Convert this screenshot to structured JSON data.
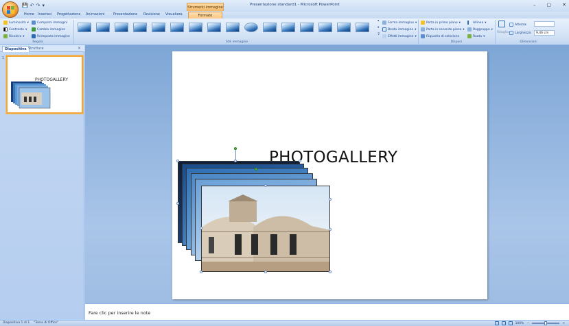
{
  "window": {
    "title": "Presentazione standard1 - Microsoft PowerPoint",
    "context_tab_group": "Strumenti immagine",
    "minimize": "–",
    "restore": "▢",
    "close": "✕"
  },
  "qat": {
    "save": "💾",
    "undo": "↶",
    "redo": "↷",
    "more": "▾"
  },
  "tabs": [
    "Home",
    "Inserisci",
    "Progettazione",
    "Animazioni",
    "Presentazione",
    "Revisione",
    "Visualizza"
  ],
  "active_tab": "Formato",
  "ribbon": {
    "regola": {
      "label": "Regola",
      "brightness": "Luminosità",
      "contrast": "Contrasto",
      "recolor": "Ricolora",
      "compress": "Comprimi immagini",
      "change": "Cambia immagine",
      "reset": "Reimposta immagine"
    },
    "stili": {
      "label": "Stili immagine",
      "thumb_count": 16
    },
    "stili_right": {
      "shape": "Forma immagine",
      "border": "Bordo immagine",
      "effects": "Effetti immagine"
    },
    "disponi": {
      "label": "Disponi",
      "bring_front": "Porta in primo piano",
      "send_back": "Porta in secondo piano",
      "selection_pane": "Riquadro di selezione",
      "align": "Allinea",
      "group": "Raggruppa",
      "rotate": "Ruota"
    },
    "dimensioni": {
      "label": "Dimensioni",
      "crop": "Ritaglia",
      "height_label": "Altezza:",
      "height_value": "",
      "width_label": "Larghezza:",
      "width_value": "9,46 cm"
    }
  },
  "pane": {
    "tab_slides": "Diapositive",
    "tab_outline": "Struttura",
    "close": "×",
    "slide_number": "1",
    "thumb_title": "PHOTOGALLERY"
  },
  "slide": {
    "title": "PHOTOGALLERY"
  },
  "notes": {
    "placeholder": "Fare clic per inserire le note"
  },
  "status": {
    "slide_info": "Diapositiva 1 di 1",
    "theme": "\"Tema di Office\"",
    "zoom": "100%",
    "zoom_out": "−",
    "zoom_in": "+"
  },
  "colors": {
    "accent": "#f4a53a",
    "ribbon_text": "#15428b",
    "canvas_bg": "#8fb2dd"
  }
}
